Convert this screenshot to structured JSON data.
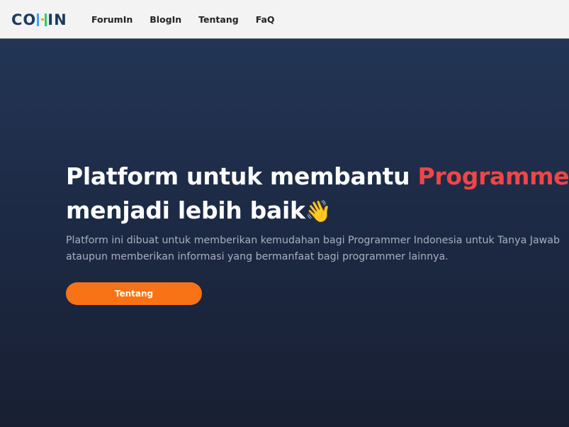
{
  "navbar": {
    "logo": {
      "left_text": "CO",
      "right_text": "IN",
      "accent_colors": [
        "#3aa0ff",
        "#2ecc71",
        "#f5a623"
      ]
    },
    "links": [
      {
        "label": "ForumIn"
      },
      {
        "label": "BlogIn"
      },
      {
        "label": "Tentang"
      },
      {
        "label": "FaQ"
      }
    ]
  },
  "hero": {
    "title_part1": "Platform untuk membantu ",
    "title_highlight": "Programmer",
    "title_part2": "menjadi lebih baik",
    "title_emoji": "👋",
    "description": "Platform ini dibuat untuk memberikan kemudahan bagi Programmer Indonesia untuk Tanya Jawab ataupun memberikan informasi yang bermanfaat bagi programmer lainnya.",
    "button_label": "Tentang"
  },
  "colors": {
    "accent": "#f97316",
    "highlight": "#ef4646",
    "background_top": "#233555",
    "background_bottom": "#181f33"
  }
}
